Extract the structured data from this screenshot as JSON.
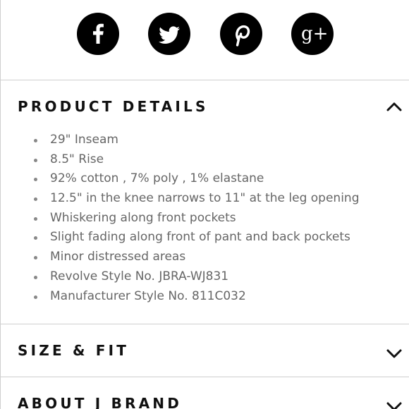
{
  "social": [
    {
      "id": "facebook",
      "icon": "facebook-icon"
    },
    {
      "id": "twitter",
      "icon": "twitter-icon"
    },
    {
      "id": "pinterest",
      "icon": "pinterest-icon"
    },
    {
      "id": "google-plus",
      "icon": "google-plus-icon",
      "glyph": "g+"
    }
  ],
  "sections": [
    {
      "title": "PRODUCT DETAILS",
      "expanded": true,
      "chevron": "chevron-up-icon"
    },
    {
      "title": "SIZE & FIT",
      "expanded": false,
      "chevron": "chevron-down-icon"
    },
    {
      "title": "ABOUT J BRAND",
      "expanded": false,
      "chevron": "chevron-down-icon"
    }
  ],
  "product_details": [
    "29\" Inseam",
    "8.5\" Rise",
    "92% cotton , 7% poly , 1% elastane",
    "12.5\" in the knee narrows to 11\" at the leg opening",
    "Whiskering along front pockets",
    "Slight fading along front of pant and back pockets",
    "Minor distressed areas",
    "Revolve Style No. JBRA-WJ831",
    "Manufacturer Style No. 811C032"
  ],
  "colors": {
    "icon_bg": "#000000",
    "title": "#111111",
    "body_text": "#666666",
    "divider": "#cfcfcf"
  }
}
